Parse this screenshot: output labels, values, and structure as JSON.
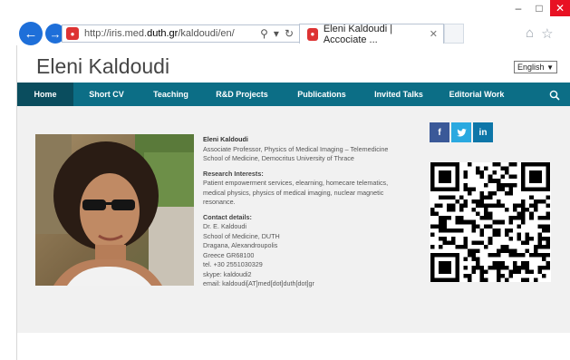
{
  "browser": {
    "url_prefix": "http://iris.med.",
    "url_domain": "duth.gr",
    "url_suffix": "/kaldoudi/en/",
    "tab_title": "Eleni Kaldoudi | Accociate ...",
    "colors": {
      "accent": "#1e6fd9",
      "close": "#e81123"
    }
  },
  "header": {
    "title": "Eleni Kaldoudi",
    "language": "English"
  },
  "nav": {
    "items": [
      {
        "label": "Home"
      },
      {
        "label": "Short CV"
      },
      {
        "label": "Teaching"
      },
      {
        "label": "R&D Projects"
      },
      {
        "label": "Publications"
      },
      {
        "label": "Invited Talks"
      },
      {
        "label": "Editorial Work"
      }
    ],
    "color": "#0c6e86",
    "active_color": "#0a4d5e"
  },
  "profile": {
    "name": "Eleni Kaldoudi",
    "position": "Associate Professor, Physics of Medical Imaging – Telemedicine",
    "affiliation": "School of Medicine, Democritus University of Thrace",
    "interests_heading": "Research Interests:",
    "interests_lines": [
      "Patient empowerment services, elearning, homecare telematics,",
      "medical physics, physics of medical imaging, nuclear magnetic",
      "resonance."
    ],
    "contact_heading": "Contact details:",
    "contact_lines": [
      "Dr. E. Kaldoudi",
      "School of Medicine, DUTH",
      "Dragana, Alexandroupolis",
      "Greece GR68100",
      "tel. +30 2551030329",
      "skype: kaldoudi2",
      "email: kaldoudi[AT]med[dot]duth[dot]gr"
    ]
  },
  "social": {
    "facebook": "f",
    "twitter": "t",
    "linkedin": "in"
  }
}
